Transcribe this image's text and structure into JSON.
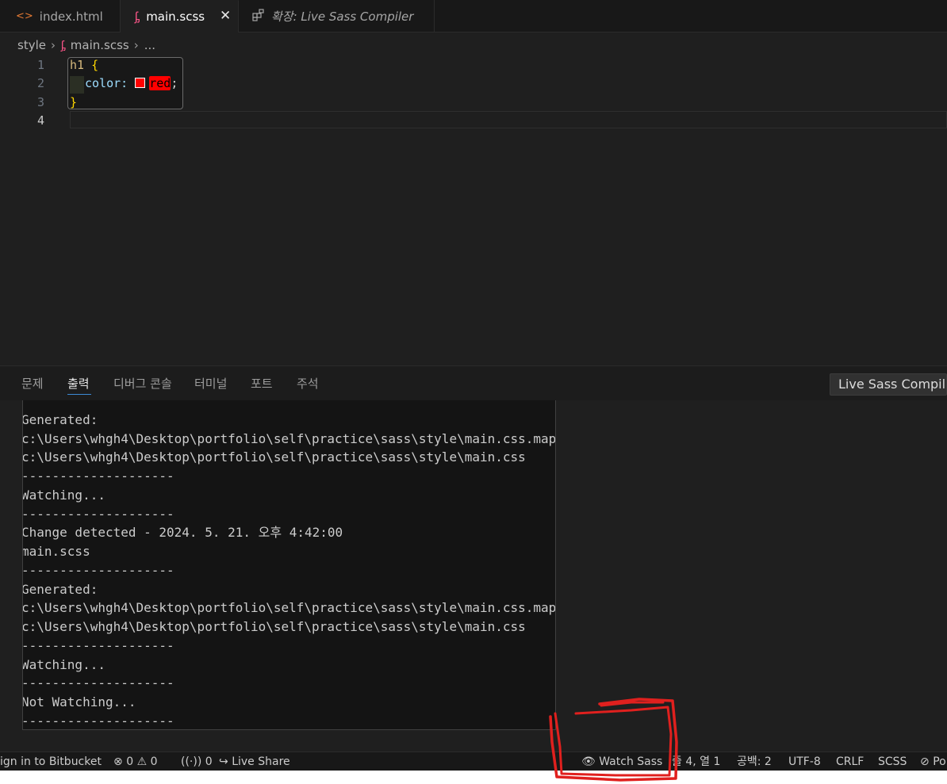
{
  "tabs": [
    {
      "label": "index.html",
      "icon": "html-file-icon"
    },
    {
      "label": "main.scss",
      "icon": "sass-file-icon",
      "close": "✕"
    },
    {
      "label": "확장: Live Sass Compiler",
      "icon": "extension-icon"
    }
  ],
  "breadcrumb": {
    "folder": "style",
    "file": "main.scss",
    "more": "..."
  },
  "editor": {
    "line_numbers": [
      "1",
      "2",
      "3",
      "4"
    ],
    "lines": {
      "l1_selector": "h1",
      "l1_brace": "{",
      "l2_property": "color:",
      "l2_value": "red",
      "l2_semicolon": ";",
      "l3_brace": "}"
    },
    "swatch_color": "#ff0000"
  },
  "panel": {
    "tabs": [
      "문제",
      "출력",
      "디버그 콘솔",
      "터미널",
      "포트",
      "주석"
    ],
    "active_tab": "출력",
    "channel": "Live Sass Compile",
    "output_lines": [
      "--------------------",
      "Generated:",
      "c:\\Users\\whgh4\\Desktop\\portfolio\\self\\practice\\sass\\style\\main.css.map",
      "c:\\Users\\whgh4\\Desktop\\portfolio\\self\\practice\\sass\\style\\main.css",
      "--------------------",
      "Watching...",
      "--------------------",
      "Change detected - 2024. 5. 21. 오후 4:42:00",
      "main.scss",
      "--------------------",
      "Generated:",
      "c:\\Users\\whgh4\\Desktop\\portfolio\\self\\practice\\sass\\style\\main.css.map",
      "c:\\Users\\whgh4\\Desktop\\portfolio\\self\\practice\\sass\\style\\main.css",
      "--------------------",
      "Watching...",
      "--------------------",
      "Not Watching...",
      "--------------------"
    ]
  },
  "statusbar": {
    "bitbucket": "ign in to Bitbucket",
    "errors": "0",
    "warnings": "0",
    "ports": "0",
    "live_share": "Live Share",
    "watch_sass": "Watch Sass",
    "position": "줄 4, 열 1",
    "spaces": "공백: 2",
    "encoding": "UTF-8",
    "eol": "CRLF",
    "language": "SCSS",
    "trailing": "Po"
  },
  "annotation_color": "#e0201e"
}
